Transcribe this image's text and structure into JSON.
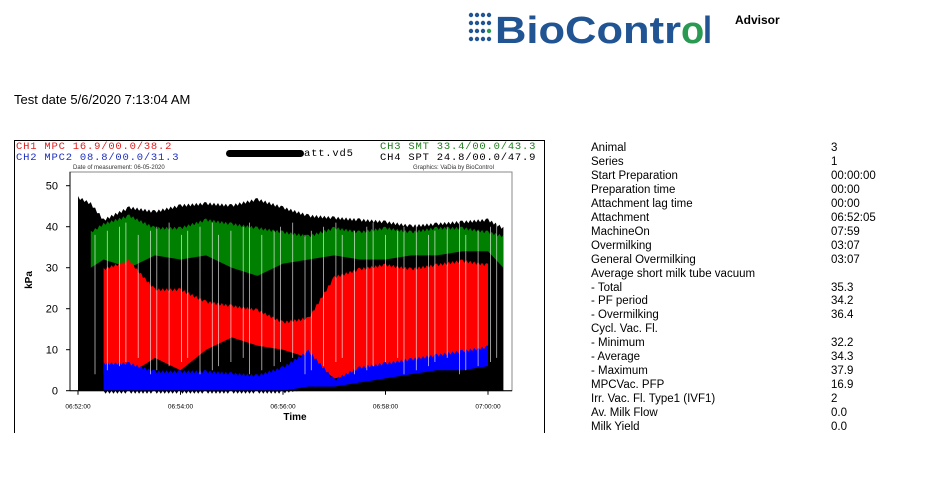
{
  "header": {
    "logo_text": "BioControl",
    "advisor_label": "Advisor",
    "brand_blue": "#215493",
    "brand_green": "#2a9a52"
  },
  "test_date": "Test date 5/6/2020 7:13:04 AM",
  "chart_header": {
    "ch1": "CH1 MPC 16.9/00.0/38.2",
    "ch2": "CH2 MPC2 08.8/00.0/31.3",
    "file": "att.vd5",
    "ch3": "CH3 SMT 33.4/00.0/43.3",
    "ch4": "CH4 SPT 24.8/00.0/47.9",
    "measurement_date": "Date of measurement: 06-05-2020",
    "graphics_credit": "Graphics: VaDia by BioControl"
  },
  "chart_data": {
    "type": "area",
    "xlabel": "Time",
    "ylabel": "kPa",
    "ylim": [
      0,
      52
    ],
    "xlim": [
      "06:51:50",
      "07:00:25"
    ],
    "x_ticks": [
      "06:52:00",
      "06:54:00",
      "06:56:00",
      "06:58:00",
      "07:00:00"
    ],
    "y_ticks": [
      0,
      10,
      20,
      30,
      40,
      50
    ],
    "grid": false,
    "x": [
      "06:52:00",
      "06:52:15",
      "06:52:30",
      "06:53:00",
      "06:53:30",
      "06:54:00",
      "06:54:30",
      "06:55:00",
      "06:55:30",
      "06:56:00",
      "06:56:30",
      "06:57:00",
      "06:57:30",
      "06:58:00",
      "06:58:30",
      "06:59:00",
      "06:59:30",
      "07:00:00",
      "07:00:18"
    ],
    "series": [
      {
        "name": "CH4 SPT",
        "color": "#000000",
        "upper": [
          47.5,
          46,
          42,
          45,
          44,
          45.5,
          46,
          45.5,
          47,
          45,
          43,
          42.5,
          42,
          41.5,
          40.5,
          41,
          41.5,
          42,
          40
        ],
        "lower": [
          0,
          0,
          0,
          0,
          0,
          0,
          0,
          0,
          0,
          0,
          0,
          0,
          0,
          0,
          0,
          0,
          0,
          0,
          0
        ]
      },
      {
        "name": "CH3 SMT",
        "color": "#008000",
        "upper": [
          null,
          39,
          41,
          43,
          40,
          40,
          42,
          41,
          40,
          39,
          38,
          40,
          39,
          40,
          39,
          40,
          40,
          39,
          38
        ],
        "lower": [
          null,
          30,
          32,
          30,
          33,
          32,
          33,
          30,
          28,
          31,
          32,
          33,
          32,
          32,
          33,
          33,
          34,
          34,
          30
        ]
      },
      {
        "name": "CH1 MPC",
        "color": "#ff0000",
        "upper": [
          null,
          null,
          30,
          32,
          25,
          25,
          22,
          21,
          20,
          17,
          18,
          28,
          30,
          31,
          30,
          31,
          32,
          31,
          null
        ],
        "lower": [
          null,
          null,
          4,
          4,
          8,
          5,
          10,
          13,
          11,
          10,
          8,
          3,
          4,
          5,
          7,
          8,
          9,
          10,
          null
        ]
      },
      {
        "name": "CH2 MPC2",
        "color": "#0000ff",
        "upper": [
          null,
          null,
          7,
          7,
          5,
          5,
          5,
          4.5,
          4,
          6,
          10,
          3,
          6,
          7,
          8,
          9,
          10,
          11,
          null
        ],
        "lower": [
          null,
          null,
          0,
          0,
          0,
          0,
          0,
          0,
          0,
          0,
          1,
          1,
          2,
          3,
          4,
          5,
          5,
          6,
          null
        ]
      }
    ]
  },
  "stats": [
    {
      "label": "Animal",
      "value": "3"
    },
    {
      "label": "Series",
      "value": "1"
    },
    {
      "label": "Start Preparation",
      "value": "00:00:00"
    },
    {
      "label": "Preparation time",
      "value": "00:00"
    },
    {
      "label": "Attachment lag time",
      "value": "00:00"
    },
    {
      "label": "Attachment",
      "value": "06:52:05"
    },
    {
      "label": "MachineOn",
      "value": "07:59"
    },
    {
      "label": "Overmilking",
      "value": "03:07"
    },
    {
      "label": "General Overmilking",
      "value": "03:07"
    },
    {
      "label": "Average short milk tube vacuum",
      "value": ""
    },
    {
      "label": "- Total",
      "value": "35.3"
    },
    {
      "label": "- PF period",
      "value": "34.2"
    },
    {
      "label": "- Overmilking",
      "value": "36.4"
    },
    {
      "label": "Cycl. Vac. Fl.",
      "value": ""
    },
    {
      "label": "- Minimum",
      "value": "32.2"
    },
    {
      "label": "- Average",
      "value": "34.3"
    },
    {
      "label": "- Maximum",
      "value": "37.9"
    },
    {
      "label": "MPCVac. PFP",
      "value": "16.9"
    },
    {
      "label": "Irr. Vac. Fl. Type1 (IVF1)",
      "value": "2"
    },
    {
      "label": "Av. Milk Flow",
      "value": "0.0"
    },
    {
      "label": "Milk Yield",
      "value": "0.0"
    }
  ]
}
